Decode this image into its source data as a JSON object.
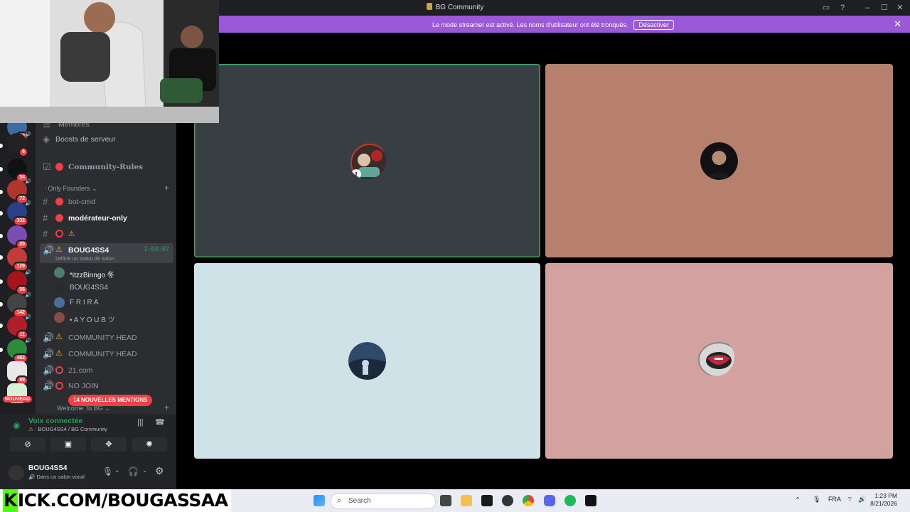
{
  "window": {
    "title": "BG Community"
  },
  "banner": {
    "message": "Le mode streamer est activé. Les noms d'utilisateur ont été tronqués.",
    "button": "Désactiver"
  },
  "rail": {
    "badges": [
      "63",
      "6",
      "34",
      "72",
      "332",
      "20",
      "129",
      "56",
      "142",
      "11",
      "482",
      "88"
    ],
    "new_label": "NOUVEAU"
  },
  "channels": {
    "members_partial": "Membres",
    "boosts": "Boosts de serveur",
    "rules": "Community-Rules",
    "category_founders": "Only Founders",
    "bot_cmd": "bot-cmd",
    "moderateur": "modérateur-only",
    "voice_active": "BOUG4SS4",
    "voice_timer": "3:04:07",
    "voice_status": "Définir un statut de salon",
    "members": [
      "*itzzBinngo 冬",
      "BOUG4SS4",
      "F R I R A",
      "• A Y O U B ツ"
    ],
    "community_head_1": "COMMUNITY HEAD",
    "community_head_2": "COMMUNITY HEAD",
    "ch_21": "21.com",
    "no_join": "NO JOIN",
    "category_welcome": "Welcome To BG",
    "mentions": "14 NOUVELLES MENTIONS"
  },
  "voice": {
    "status": "Voix connectée",
    "location": "BOUG4SS4 / BG Community"
  },
  "user": {
    "name": "BOUG4SS4",
    "status": "Dans un salon vocal"
  },
  "stage": {
    "tiles": [
      {
        "bg": "#373f44",
        "border": "#3ba55d",
        "avatar": "group-avatar"
      },
      {
        "bg": "#b7806c",
        "border": "none",
        "avatar": "man-avatar"
      },
      {
        "bg": "#cfe2e7",
        "border": "none",
        "avatar": "landscape-avatar"
      },
      {
        "bg": "#d4a1a1",
        "border": "none",
        "avatar": "mask-avatar"
      }
    ]
  },
  "overlay": {
    "kick_text": "KICK.COM/BOUGASSAA"
  },
  "taskbar": {
    "search_placeholder": "Search",
    "lang": "FRA",
    "time": "1:23 PM",
    "date": "8/21/2026"
  }
}
